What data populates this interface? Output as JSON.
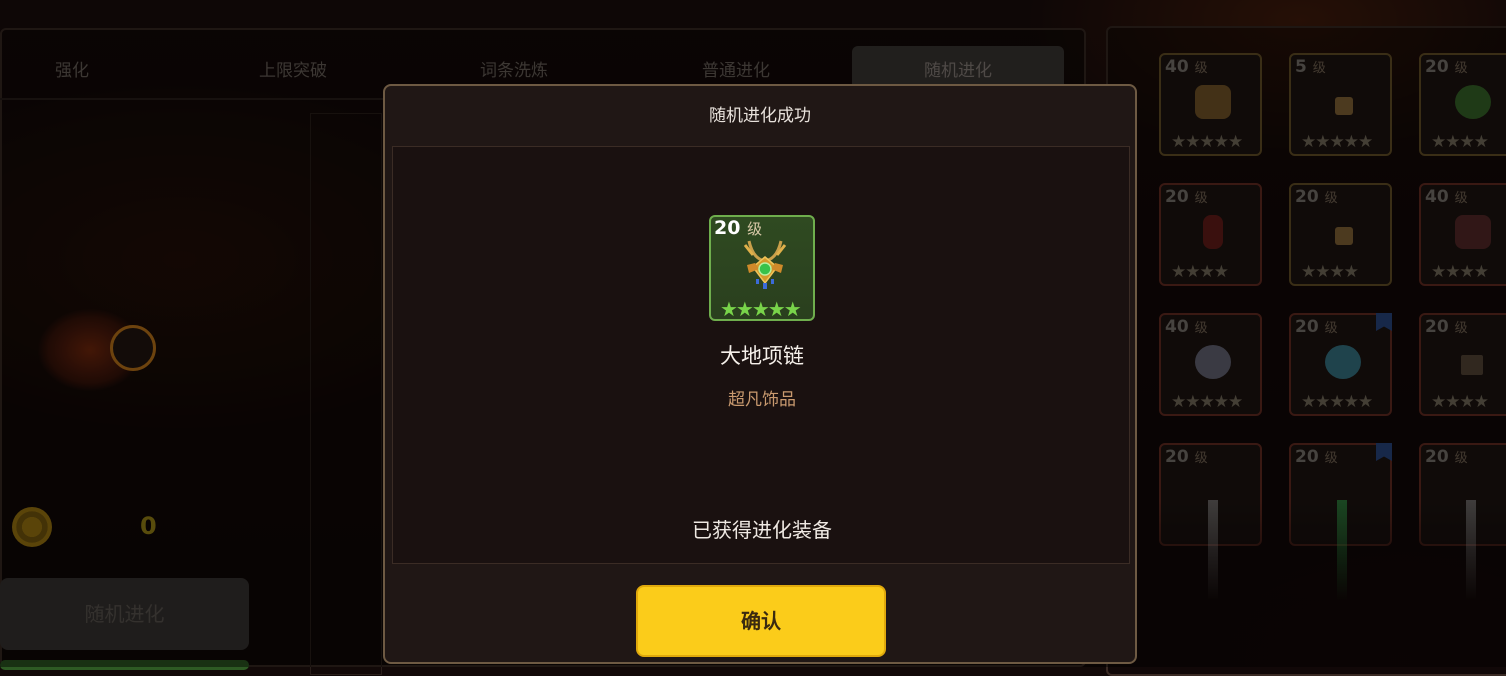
{
  "tabs": [
    {
      "label": "强化"
    },
    {
      "label": "上限突破"
    },
    {
      "label": "词条洗炼"
    },
    {
      "label": "普通进化"
    },
    {
      "label": "随机进化"
    }
  ],
  "left": {
    "coin_count": "0",
    "action_button": "随机进化"
  },
  "inventory": [
    {
      "level": "40",
      "unit": "级",
      "stars": "★★★★★"
    },
    {
      "level": "5",
      "unit": "级",
      "stars": "★★★★★"
    },
    {
      "level": "20",
      "unit": "级",
      "stars": "★★★★"
    },
    {
      "level": "20",
      "unit": "级",
      "stars": "★★★★"
    },
    {
      "level": "20",
      "unit": "级",
      "stars": "★★★★"
    },
    {
      "level": "40",
      "unit": "级",
      "stars": "★★★★"
    },
    {
      "level": "40",
      "unit": "级",
      "stars": "★★★★★"
    },
    {
      "level": "20",
      "unit": "级",
      "stars": "★★★★★"
    },
    {
      "level": "20",
      "unit": "级",
      "stars": "★★★★"
    },
    {
      "level": "20",
      "unit": "级",
      "stars": ""
    },
    {
      "level": "20",
      "unit": "级",
      "stars": ""
    },
    {
      "level": "20",
      "unit": "级",
      "stars": ""
    }
  ],
  "modal": {
    "title": "随机进化成功",
    "item": {
      "level": "20",
      "level_unit": "级",
      "stars": "★★★★★",
      "name": "大地项链",
      "rarity": "超凡饰品",
      "icon": "necklace-icon"
    },
    "message": "已获得进化装备",
    "confirm_label": "确认"
  },
  "colors": {
    "confirm": "#fbcc1a",
    "item_border": "#6fae4d",
    "rarity_text": "#c99a6f"
  }
}
